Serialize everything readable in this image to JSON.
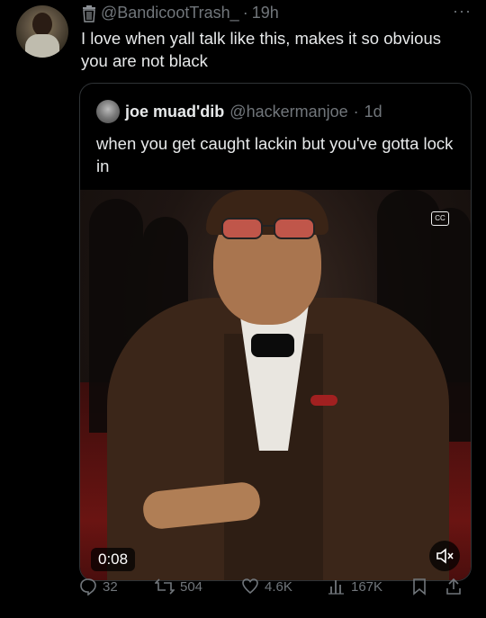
{
  "tweet": {
    "handle": "@BandicootTrash_",
    "separator": "·",
    "time": "19h",
    "text": "I love when yall talk like this, makes it so obvious you are not black",
    "more_label": "···"
  },
  "quote": {
    "name": "joe muad'dib",
    "handle": "@hackermanjoe",
    "separator": "·",
    "time": "1d",
    "text": "when you get caught lackin but you've gotta lock in",
    "video": {
      "timestamp": "0:08",
      "captions_icon": "closed-captions-icon",
      "mute_icon": "speaker-muted-icon"
    }
  },
  "actions": {
    "replies": "32",
    "reposts": "504",
    "likes": "4.6K",
    "views": "167K"
  },
  "icons": {
    "reply": "reply-icon",
    "repost": "repost-icon",
    "like": "heart-icon",
    "views": "views-icon",
    "bookmark": "bookmark-icon",
    "share": "share-icon"
  }
}
